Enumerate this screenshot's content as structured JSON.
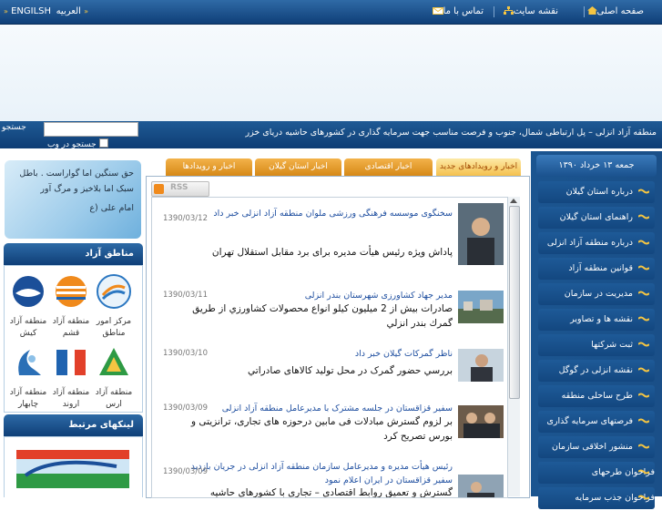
{
  "topbar": {
    "home": "صفحه اصلی",
    "sitemap": "نقشه سایت",
    "contact": "تماس با ما",
    "english": "ENGILSH",
    "arabic": "العربیه"
  },
  "slogan": "منطقه آزاد انزلی – پل ارتباطی شمال، جنوب و فرصت مناسب جهت سرمایه گذاری در کشورهای حاشیه دریای خزر",
  "search": {
    "label": "جستجو",
    "web_label": "جستجو در وب",
    "value": ""
  },
  "quote": {
    "text": "حق سنگین اما گواراست . باطل سبک اما بلاخیز و مرگ آور",
    "author": "امام علی (ع"
  },
  "zones": {
    "title": "مناطق آزاد",
    "items": [
      {
        "label": "مرکز امور مناطق"
      },
      {
        "label": "منطقه آزاد قشم"
      },
      {
        "label": "منطقه آزاد کیش"
      },
      {
        "label": "منطقه آزاد ارس"
      },
      {
        "label": "منطقه آزاد اروند"
      },
      {
        "label": "منطقه آزاد چابهار"
      }
    ]
  },
  "links": {
    "title": "لینکهای مرتبط"
  },
  "tabs": [
    {
      "label": "اخبار و رویدادهای جدید",
      "active": true
    },
    {
      "label": "اخبار اقتصادی",
      "active": false
    },
    {
      "label": "اخبار استان گیلان",
      "active": false
    },
    {
      "label": "اخبار و رویدادها",
      "active": false
    }
  ],
  "rss_label": "RSS",
  "news": [
    {
      "title": "سخنگوی موسسه فرهنگی ورزشی ملوان منطقه آزاد انزلی خبر داد",
      "date": "1390/03/12",
      "body": "پاداش ویژه رئیس هیأت مدیره برای برد مقابل استقلال تهران"
    },
    {
      "title": "مدیر جهاد کشاورزی شهرستان بندر انزلی",
      "date": "1390/03/11",
      "body": "صادرات بیش از 2 میلیون کیلو انواع محصولات کشاورزي از طريق گمرك بندر انزلي"
    },
    {
      "title": "ناظر گمرکات گیلان خبر داد",
      "date": "1390/03/10",
      "body": "بررسي حضور گمرک در محل تولید کالاهای صادراتي"
    },
    {
      "title": "سفیر قزاقستان در جلسه مشترک با مدیرعامل منطقه آزاد انزلی",
      "date": "1390/03/09",
      "body": "بر لزوم گسترش مبادلات فی مابین درحوزه های تجاری، ترانزیتی و بورس تصریح کرد"
    },
    {
      "title": "رئیس هیأت مدیره و مدیرعامل سازمان منطقه آزاد انزلی در جریان بازدید سفیر قزاقستان در ایران اعلام نمود",
      "date": "1390/03/09",
      "body": "گسترش و تعمیق روابط اقتصادی – تجاری با کشورهای حاشیه دریای"
    }
  ],
  "sidebar": {
    "date": "جمعه ۱۳ خرداد ۱۳۹۰",
    "items": [
      {
        "label": "درباره استان گیلان"
      },
      {
        "label": "راهنمای استان گیلان"
      },
      {
        "label": "درباره منطقه آزاد انزلی"
      },
      {
        "label": "قوانین منطقه آزاد"
      },
      {
        "label": "مدیریت در سازمان"
      },
      {
        "label": "نقشه ها و تصاویر"
      },
      {
        "label": "ثبت شرکتها"
      },
      {
        "label": "نقشه انزلی در گوگل"
      },
      {
        "label": "طرح ساحلی منطقه"
      },
      {
        "label": "فرصتهای سرمایه گذاری"
      },
      {
        "label": "منشور اخلاقی سازمان"
      },
      {
        "label": "فراخوان طرحهای پژوهشی"
      },
      {
        "label": "فراخوان جذب سرمایه گذار"
      }
    ]
  },
  "colors": {
    "header_blue": "#0f3f78",
    "tab_orange": "#e39a2a",
    "link_blue": "#1f4fa0"
  }
}
